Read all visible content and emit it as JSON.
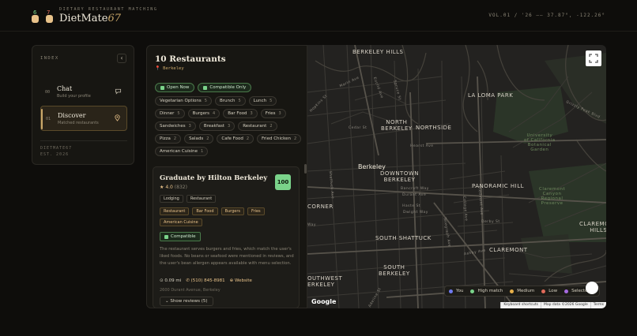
{
  "header": {
    "kicker": "DIETARY RESTAURANT MATCHING",
    "brand": "DietMate",
    "brand_num": "67",
    "logo_badge1": "6",
    "logo_badge2": "7",
    "meta": "VOL.01 / '26  ——  37.87°, -122.26°"
  },
  "sidebar": {
    "label": "INDEX",
    "toggle": "‹",
    "items": [
      {
        "num": "00",
        "title": "Chat",
        "sub": "Build your profile",
        "icon": "chat-bubble-icon"
      },
      {
        "num": "01",
        "title": "Discover",
        "sub": "Matched restaurants",
        "icon": "map-pin-icon"
      }
    ],
    "footer1": "DIETMATE67",
    "footer2": "EST. 2026"
  },
  "results": {
    "title": "10 Restaurants",
    "location": "Berkeley",
    "filters": [
      "Open Now",
      "Compatible Only"
    ],
    "cuisines": [
      {
        "name": "Vegetarian Options",
        "count": "5"
      },
      {
        "name": "Brunch",
        "count": "5"
      },
      {
        "name": "Lunch",
        "count": "5"
      },
      {
        "name": "Dinner",
        "count": "5"
      },
      {
        "name": "Burgers",
        "count": "4"
      },
      {
        "name": "Bar Food",
        "count": "3"
      },
      {
        "name": "Fries",
        "count": "3"
      },
      {
        "name": "Sandwiches",
        "count": "3"
      },
      {
        "name": "Breakfast",
        "count": "3"
      },
      {
        "name": "Restaurant",
        "count": "2"
      },
      {
        "name": "Pizza",
        "count": "2"
      },
      {
        "name": "Salads",
        "count": "2"
      },
      {
        "name": "Cafe Food",
        "count": "2"
      },
      {
        "name": "Fried Chicken",
        "count": "2"
      },
      {
        "name": "American Cuisine",
        "count": "1"
      }
    ],
    "card": {
      "name": "Graduate by Hilton Berkeley",
      "rating": "4.0",
      "reviews": "(832)",
      "score": "100",
      "types": [
        "Lodging",
        "Restaurant"
      ],
      "foods": [
        "Restaurant",
        "Bar Food",
        "Burgers",
        "Fries",
        "American Cuisine"
      ],
      "compat": "Compatible",
      "description": "The restaurant serves burgers and fries, which match the user's liked foods. No beans or seafood were mentioned in reviews, and the user's bean allergen appears available with menu selection.",
      "distance": "0.09 mi",
      "phone": "(510) 845-8981",
      "website": "Website",
      "address": "2600 Durant Avenue, Berkeley",
      "show_reviews": "Show reviews (5)"
    }
  },
  "map": {
    "labels": {
      "berkeley_hills": "BERKELEY HILLS",
      "la_loma_park": "LA LOMA PARK",
      "north_berkeley": "NORTH\nBERKELEY",
      "northside": "NORTHSIDE",
      "berkeley": "Berkeley",
      "downtown_berkeley": "DOWNTOWN\nBERKELEY",
      "panoramic_hill": "PANORAMIC HILL",
      "corner": "CORNER",
      "south_shattuck": "SOUTH SHATTUCK",
      "claremont": "CLAREMONT",
      "claremont_hills": "CLAREMONT\nHILLS",
      "south_berkeley": "SOUTH\nBERKELEY",
      "southwest_berkeley": "OUTHWEST\nERKELEY",
      "botanical": "University\nof California\nBotanical\nGarden",
      "claremont_canyon": "Claremont\nCanyon\nRegional\nPreserve"
    },
    "streets": {
      "hearst": "Hearst Ave",
      "cedar": "Cedar St",
      "bancroft": "Bancroft Way",
      "durant": "Durant Ave",
      "haste": "Haste St",
      "dwight": "Dwight Way",
      "derby": "Derby St",
      "ashby": "Ashby Ave",
      "way": "Way",
      "grizzly": "Grizzly Peak Blvd",
      "marin": "Marin Ave",
      "euclid": "Euclid Ave",
      "spruce": "Spruce St",
      "shattuck": "Shattuck Ave",
      "telegraph": "Telegraph Ave",
      "college": "College Ave",
      "piedmont": "Piedmont Ave",
      "hopkins": "Hopkins St",
      "adeline": "Adeline St"
    },
    "legend": [
      {
        "label": "You",
        "color": "#6f7af0"
      },
      {
        "label": "High match",
        "color": "#7ad38a"
      },
      {
        "label": "Medium",
        "color": "#e8b04a"
      },
      {
        "label": "Low",
        "color": "#e06a5a"
      },
      {
        "label": "Selected",
        "color": "#a66ae0"
      }
    ],
    "google": "Google",
    "attribution": [
      "Keyboard shortcuts",
      "Map data ©2026 Google",
      "Terms"
    ]
  }
}
